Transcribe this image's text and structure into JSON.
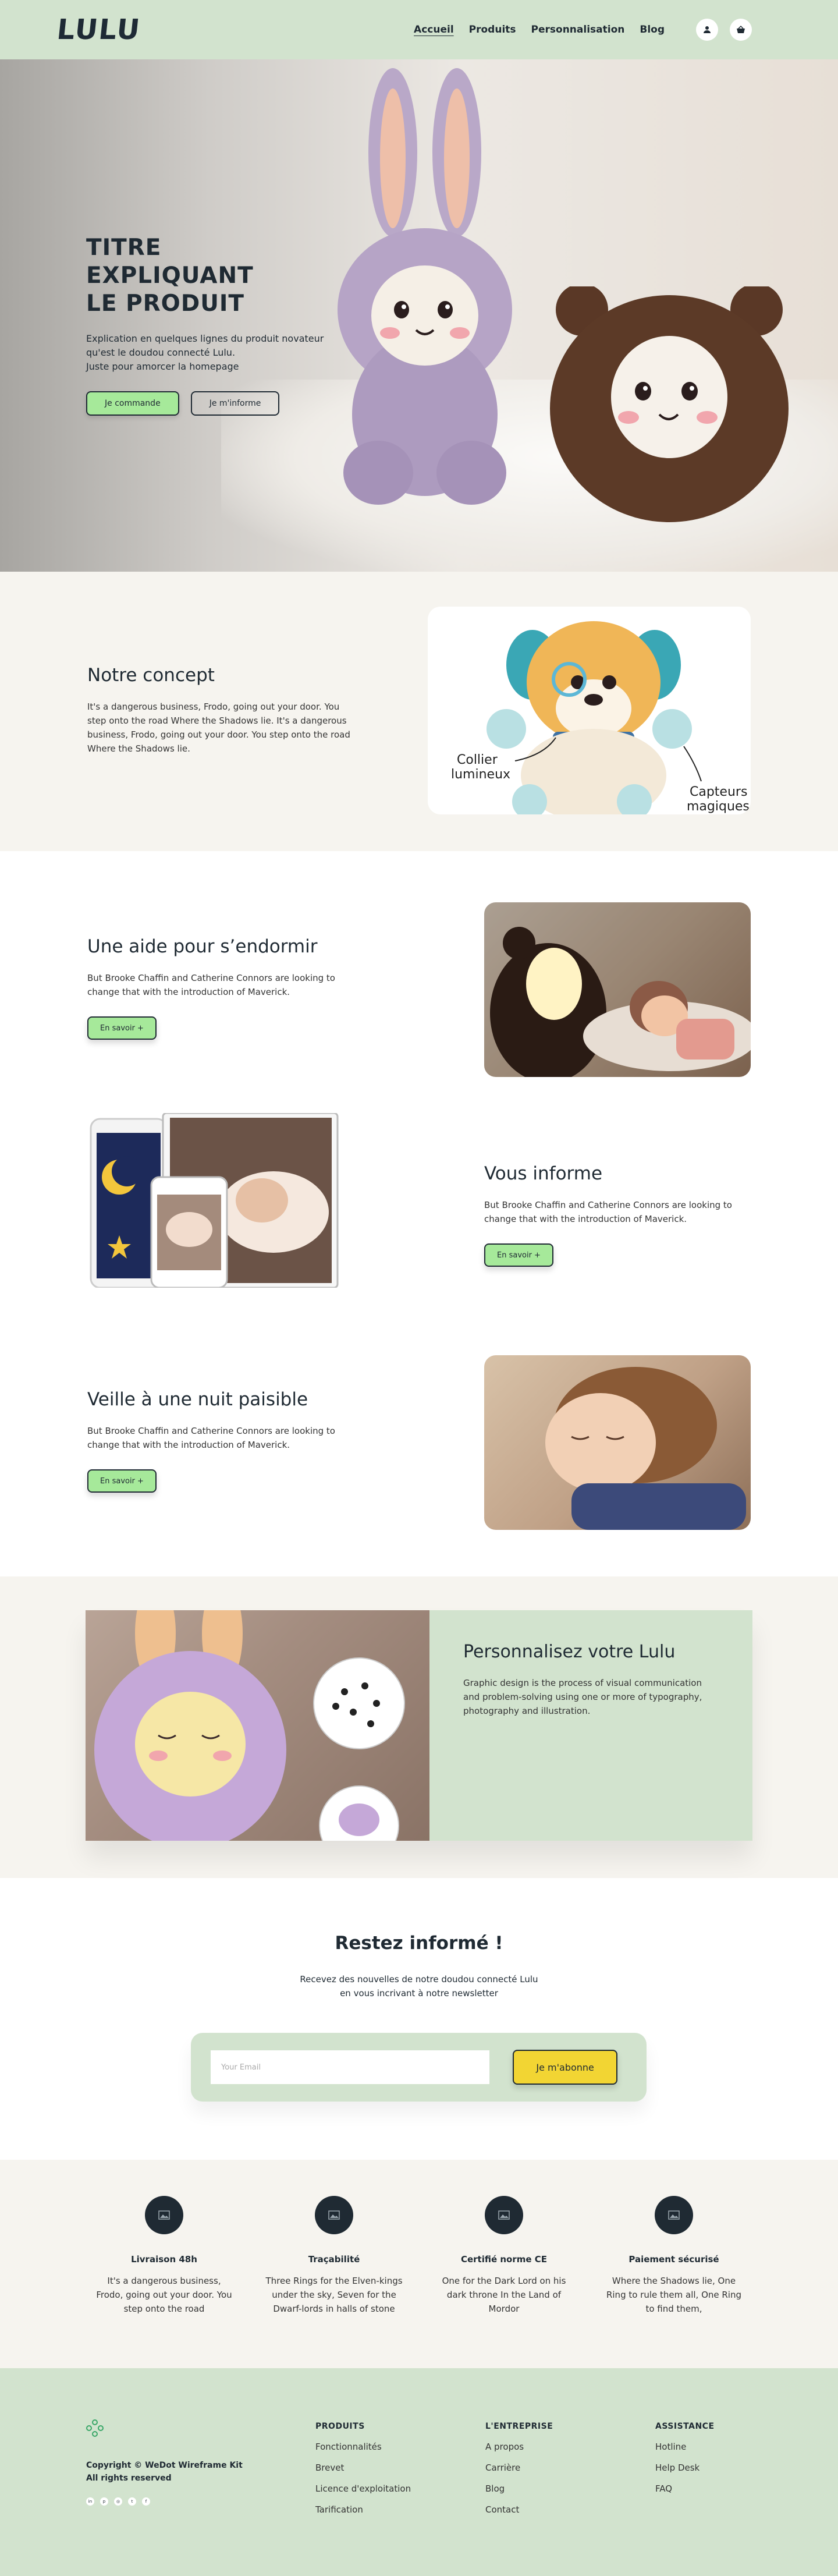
{
  "nav": {
    "logo": "LULU",
    "links": [
      "Accueil",
      "Produits",
      "Personnalisation",
      "Blog"
    ],
    "account_icon": "user-icon",
    "cart_icon": "basket-icon"
  },
  "hero": {
    "title_line1": "TITRE EXPLIQUANT",
    "title_line2": "LE PRODUIT",
    "sub_line1": "Explication en quelques lignes du produit novateur",
    "sub_line2": "qu'est le doudou connecté Lulu.",
    "sub_line3": "Juste pour amorcer la homepage",
    "cta_primary": "Je commande",
    "cta_secondary": "Je m'informe"
  },
  "concept": {
    "title": "Notre concept",
    "text": "It's a dangerous business, Frodo, going out your door. You step onto the road Where the Shadows lie. It's a dangerous business, Frodo, going out your door. You step onto the road Where the Shadows lie.",
    "label_collar_1": "Collier",
    "label_collar_2": "lumineux",
    "label_sensors_1": "Capteurs",
    "label_sensors_2": "magiques"
  },
  "features": [
    {
      "title": "Une aide pour s’endormir",
      "text": "But Brooke Chaffin and Catherine Connors are looking to change that with the introduction of Maverick.",
      "button": "En savoir +"
    },
    {
      "title": "Vous informe",
      "text": "But Brooke Chaffin and Catherine Connors are looking to change that with the introduction of Maverick.",
      "button": "En savoir +"
    },
    {
      "title": "Veille à une nuit paisible",
      "text": "But Brooke Chaffin and Catherine Connors are looking to change that with the introduction of Maverick.",
      "button": "En savoir +"
    }
  ],
  "perso": {
    "title": "Personnalisez votre Lulu",
    "text": "Graphic design is the process of visual communication and problem-solving using one or more of typography, photography and illustration."
  },
  "newsletter": {
    "title": "Restez informé !",
    "sub_line1": "Recevez des nouvelles de notre doudou connecté Lulu",
    "sub_line2": "en vous incrivant à notre newsletter",
    "placeholder": "Your Email",
    "button": "Je m'abonne"
  },
  "usps": [
    {
      "icon": "image-icon",
      "title": "Livraison 48h",
      "text": "It's a dangerous business, Frodo, going out your door. You step onto the road"
    },
    {
      "icon": "image-icon",
      "title": "Traçabilité",
      "text": "Three Rings for the Elven-kings under the sky, Seven for the Dwarf-lords in halls of stone"
    },
    {
      "icon": "image-icon",
      "title": "Certifié norme CE",
      "text": "One for the Dark Lord on his dark throne In the Land of Mordor"
    },
    {
      "icon": "image-icon",
      "title": "Paiement sécurisé",
      "text": "Where the Shadows lie, One Ring to rule them all, One Ring to find them,"
    }
  ],
  "footer": {
    "copyright_line1": "Copyright © WeDot Wireframe Kit",
    "copyright_line2": "All rights reserved",
    "social_icons": [
      "linkedin-icon",
      "pinterest-icon",
      "instagram-icon",
      "twitter-icon",
      "facebook-icon"
    ],
    "columns": [
      {
        "title": "PRODUITS",
        "links": [
          "Fonctionnalités",
          "Brevet",
          "Licence d'exploitation",
          "Tarification"
        ]
      },
      {
        "title": "L'ENTREPRISE",
        "links": [
          "A propos",
          "Carrière",
          "Blog",
          "Contact"
        ]
      },
      {
        "title": "ASSISTANCE",
        "links": [
          "Hotline",
          "Help Desk",
          "FAQ"
        ]
      }
    ]
  }
}
